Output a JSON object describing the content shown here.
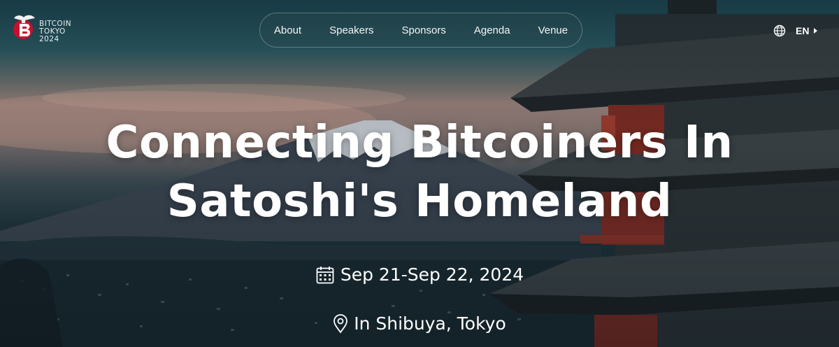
{
  "logo": {
    "line1": "BITCOIN",
    "line2": "TOKYO",
    "line3": "2024",
    "mark_color": "#c8102e",
    "icon": "bonsai-bitcoin-icon"
  },
  "nav": {
    "items": [
      {
        "label": "About"
      },
      {
        "label": "Speakers"
      },
      {
        "label": "Sponsors"
      },
      {
        "label": "Agenda"
      },
      {
        "label": "Venue"
      }
    ]
  },
  "language": {
    "icon": "globe-icon",
    "code": "EN",
    "caret_icon": "caret-right-icon"
  },
  "hero": {
    "title_line1": "Connecting Bitcoiners In",
    "title_line2": "Satoshi's Homeland",
    "date_icon": "calendar-icon",
    "date": "Sep 21-Sep 22, 2024",
    "location_icon": "map-pin-icon",
    "location": "In Shibuya, Tokyo"
  }
}
